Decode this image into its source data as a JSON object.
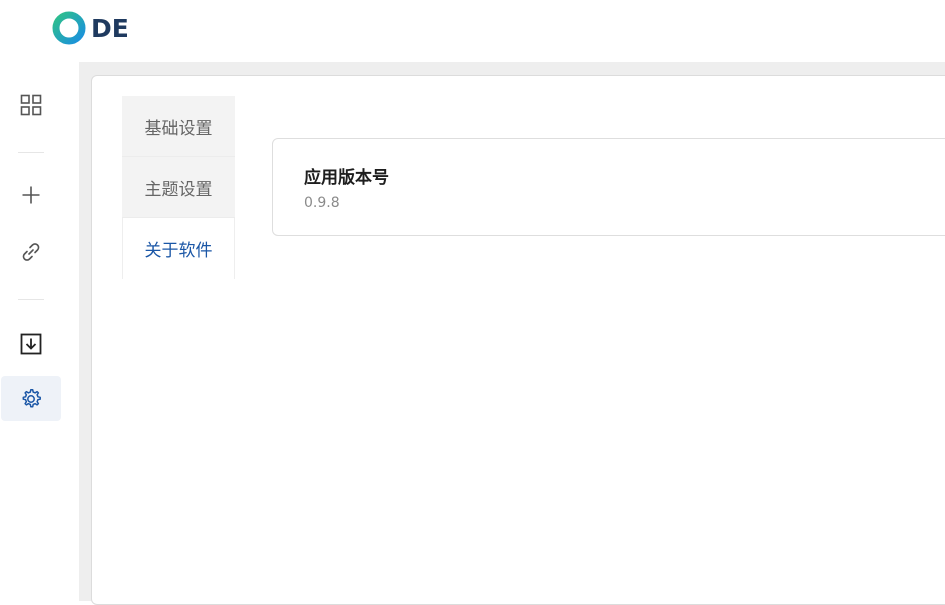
{
  "app": {
    "logo_text": "DE"
  },
  "sidebar": {
    "items": [
      {
        "icon": "grid-icon"
      },
      {
        "icon": "plus-icon"
      },
      {
        "icon": "link-icon"
      },
      {
        "icon": "download-icon"
      },
      {
        "icon": "gear-icon",
        "active": true
      }
    ]
  },
  "settings": {
    "tabs": [
      {
        "label": "基础设置"
      },
      {
        "label": "主题设置"
      },
      {
        "label": "关于软件",
        "active": true
      }
    ],
    "about": {
      "version_label": "应用版本号",
      "version_value": "0.9.8"
    }
  },
  "colors": {
    "accent": "#1a56a6",
    "logo_text": "#1f3a5f",
    "logo_ring_start": "#2ec08a",
    "logo_ring_end": "#1a8fe0"
  }
}
